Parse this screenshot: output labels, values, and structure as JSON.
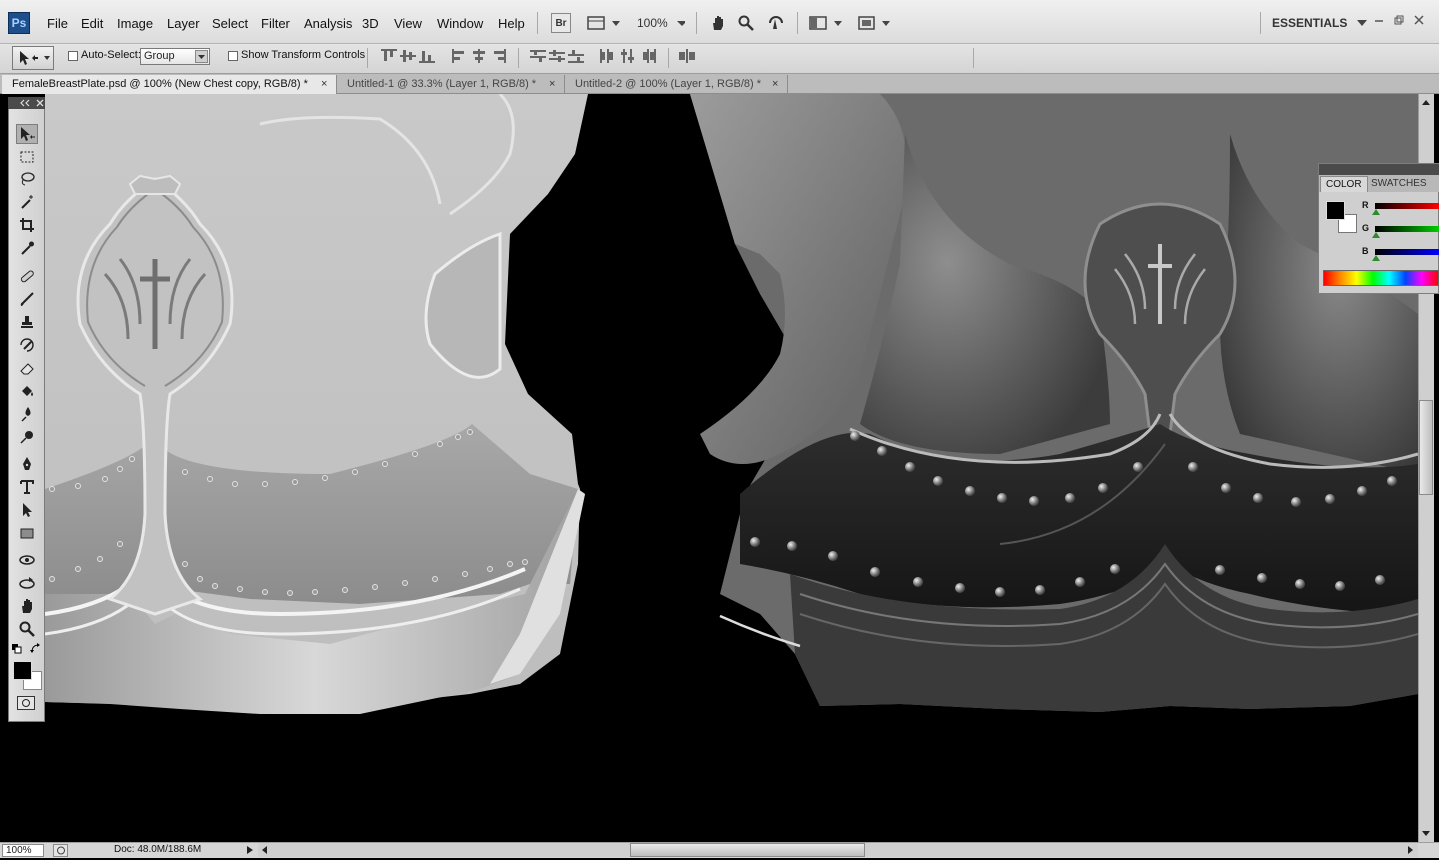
{
  "app": {
    "logo_text": "Ps"
  },
  "menu": {
    "items": [
      "File",
      "Edit",
      "Image",
      "Layer",
      "Select",
      "Filter",
      "Analysis",
      "3D",
      "View",
      "Window",
      "Help"
    ]
  },
  "appbar": {
    "bridge_label": "Br",
    "zoom": "100%",
    "workspace": "ESSENTIALS"
  },
  "options": {
    "auto_select_label": "Auto-Select:",
    "auto_select_value": "Group",
    "show_transform_label": "Show Transform Controls"
  },
  "tabs": [
    {
      "label": "FemaleBreastPlate.psd @ 100% (New Chest copy, RGB/8) *",
      "close": "×",
      "active": true
    },
    {
      "label": "Untitled-1 @ 33.3% (Layer 1, RGB/8) *",
      "close": "×",
      "active": false
    },
    {
      "label": "Untitled-2 @ 100% (Layer 1, RGB/8) *",
      "close": "×",
      "active": false
    }
  ],
  "color_panel": {
    "tabs": [
      "COLOR",
      "SWATCHES"
    ],
    "r": "R",
    "g": "G",
    "b": "B"
  },
  "status": {
    "zoom": "100%",
    "doc": "Doc: 48.0M/188.6M"
  },
  "colors": {
    "accent": "#1d4f8c",
    "foreground": "#000000",
    "background": "#ffffff"
  },
  "icons": [
    "move-tool-icon",
    "marquee-tool-icon",
    "lasso-tool-icon",
    "magic-wand-icon",
    "crop-tool-icon",
    "eyedropper-icon",
    "healing-brush-icon",
    "brush-tool-icon",
    "clone-stamp-icon",
    "history-brush-icon",
    "eraser-icon",
    "paint-bucket-icon",
    "blur-tool-icon",
    "dodge-tool-icon",
    "pen-tool-icon",
    "type-tool-icon",
    "path-selection-icon",
    "rectangle-tool-icon",
    "3d-rotate-icon",
    "3d-orbit-icon",
    "hand-tool-icon",
    "zoom-tool-icon"
  ]
}
